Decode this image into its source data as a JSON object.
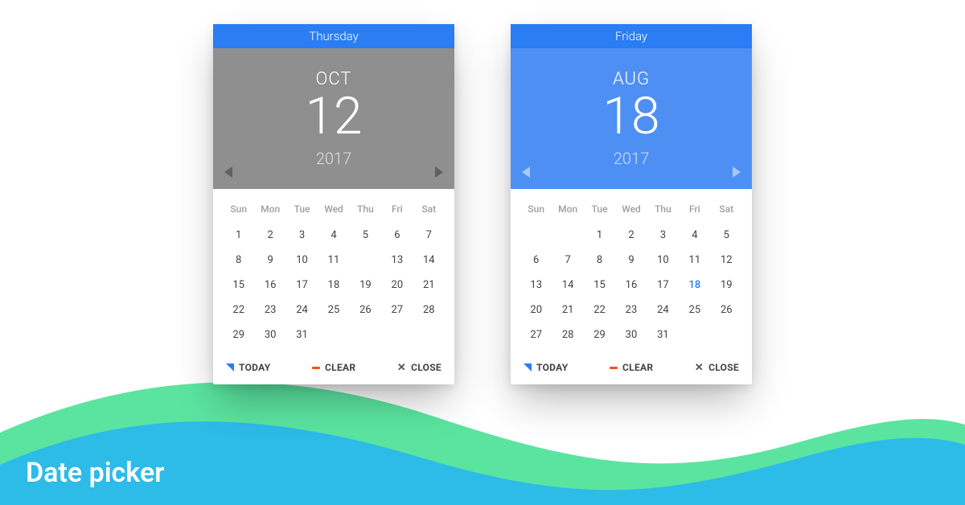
{
  "title": "Date picker",
  "colors": {
    "primary_blue": "#2A7DF3",
    "wave_green": "#52E39B",
    "wave_blue": "#2DBBE8",
    "hero_grey": "#8F8F8F",
    "hero_blue_light": "#4E8FF4",
    "bar_blue": "#2A7DF3",
    "bar_blue_b": "#2A7DF3"
  },
  "dow_labels": [
    "Sun",
    "Mon",
    "Tue",
    "Wed",
    "Thu",
    "Fri",
    "Sat"
  ],
  "buttons": {
    "today": "TODAY",
    "clear": "CLEAR",
    "close": "CLOSE"
  },
  "pickers": [
    {
      "id": "oct",
      "weekday": "Thursday",
      "month": "OCT",
      "day": "12",
      "year": "2017",
      "lead_blanks": 0,
      "days_in_month": 31,
      "selected_day": 12,
      "highlight_day": null,
      "hero_style": "grey"
    },
    {
      "id": "aug",
      "weekday": "Friday",
      "month": "AUG",
      "day": "18",
      "year": "2017",
      "lead_blanks": 2,
      "days_in_month": 31,
      "selected_day": null,
      "highlight_day": 18,
      "hero_style": "blue"
    }
  ]
}
